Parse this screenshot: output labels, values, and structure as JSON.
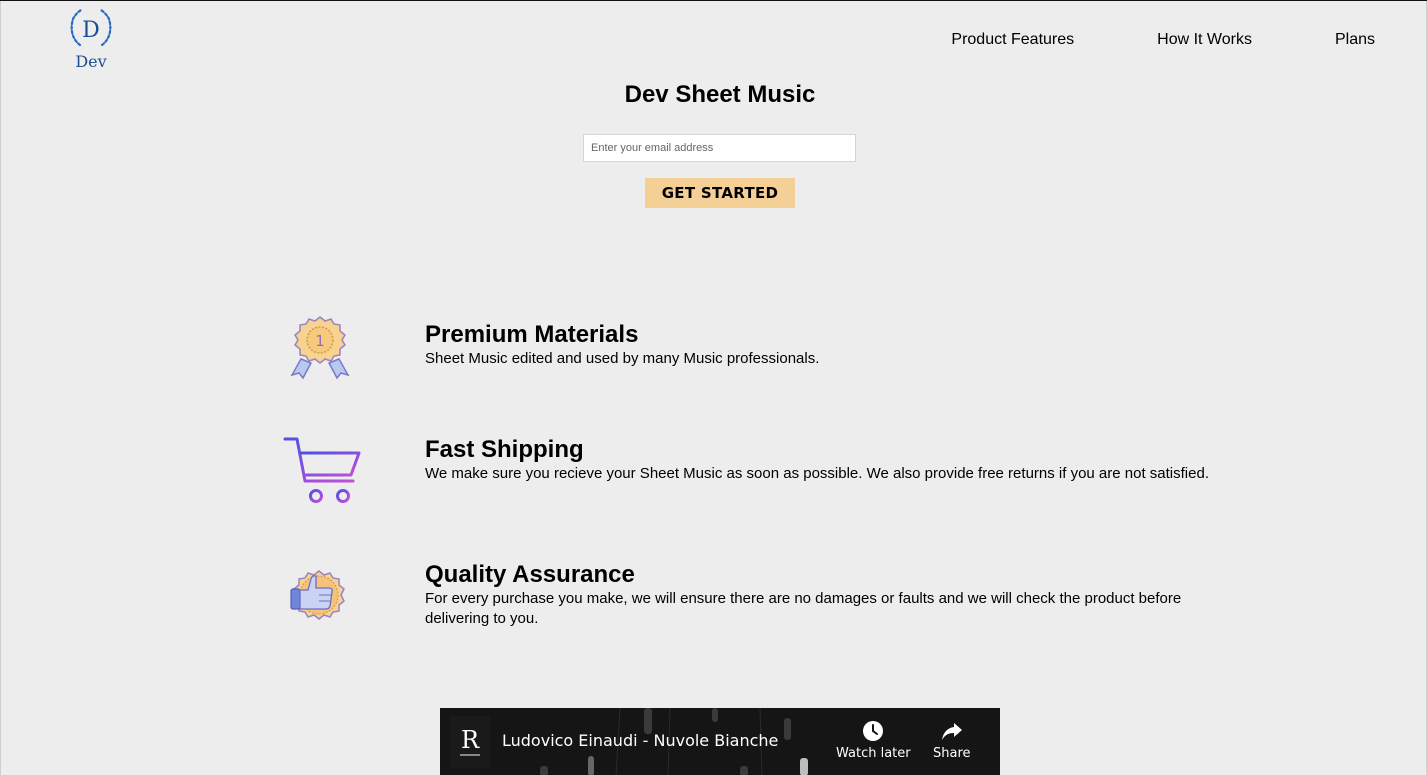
{
  "header": {
    "logo_letter": "D",
    "logo_text": "Dev"
  },
  "nav": {
    "items": [
      {
        "label": "Product Features"
      },
      {
        "label": "How It Works"
      },
      {
        "label": "Plans"
      }
    ]
  },
  "hero": {
    "title": "Dev Sheet Music",
    "email_placeholder": "Enter your email address",
    "email_value": "",
    "cta_label": "GET STARTED"
  },
  "features": [
    {
      "icon": "award-medal-icon",
      "title": "Premium Materials",
      "description": "Sheet Music edited and used by many Music professionals."
    },
    {
      "icon": "shopping-cart-icon",
      "title": "Fast Shipping",
      "description": "We make sure you recieve your Sheet Music as soon as possible. We also provide free returns if you are not satisfied."
    },
    {
      "icon": "thumbs-up-badge-icon",
      "title": "Quality Assurance",
      "description": "For every purchase you make, we will ensure there are no damages or faults and we will check the product before delivering to you."
    }
  ],
  "video": {
    "title": "Ludovico Einaudi - Nuvole Bianche",
    "watch_later_label": "Watch later",
    "share_label": "Share",
    "channel_initial": "R"
  },
  "colors": {
    "background": "#ededed",
    "cta": "#f4cf96",
    "logo_blue": "#1c4f8f",
    "video_bg": "#121212"
  }
}
